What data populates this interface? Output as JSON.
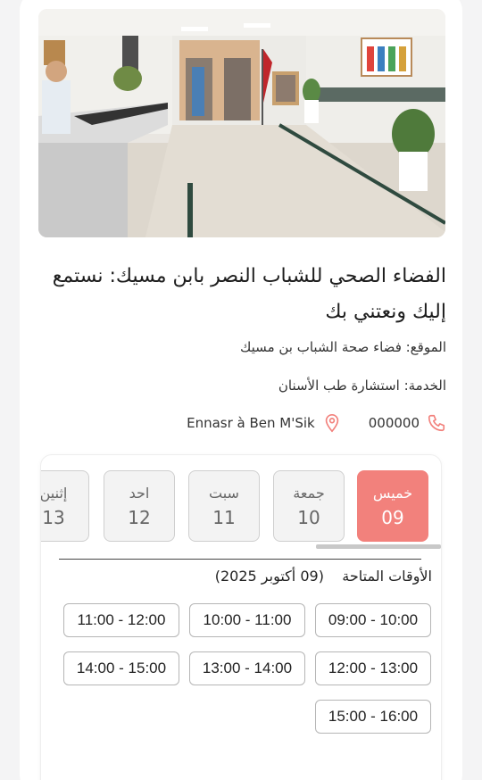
{
  "facility": {
    "title": "الفضاء الصحي للشباب النصر بابن مسيك: نستمع إليك ونعتني بك",
    "location_line": "الموقع: فضاء صحة الشباب بن مسيك",
    "service_line": "الخدمة: استشارة طب الأسنان",
    "phone": "000000",
    "address": "Ennasr à Ben M'Sik"
  },
  "icons": {
    "phone": "phone-icon",
    "location": "location-pin-icon"
  },
  "colors": {
    "accent": "#f2817c",
    "day_inactive_bg": "#f3f3f3"
  },
  "days": [
    {
      "name": "خميس",
      "num": "09",
      "selected": true
    },
    {
      "name": "جمعة",
      "num": "10",
      "selected": false
    },
    {
      "name": "سبت",
      "num": "11",
      "selected": false
    },
    {
      "name": "احد",
      "num": "12",
      "selected": false
    },
    {
      "name": "إثنين",
      "num": "13",
      "selected": false
    }
  ],
  "availability": {
    "label": "الأوقات المتاحة",
    "date": "(09 أكتوبر 2025)"
  },
  "slots": [
    "09:00 - 10:00",
    "10:00 - 11:00",
    "11:00 - 12:00",
    "12:00 - 13:00",
    "13:00 - 14:00",
    "14:00 - 15:00",
    "15:00 - 16:00"
  ]
}
